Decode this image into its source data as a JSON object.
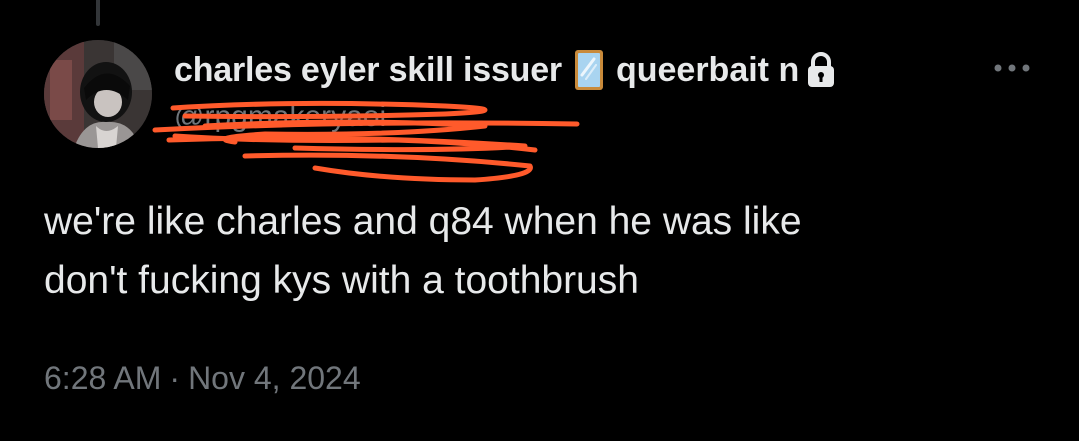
{
  "tweet": {
    "display_name": "charles eyler skill issuer",
    "name_emoji": "mirror-emoji",
    "name_suffix": "queerbait n",
    "handle": "@rpgmakeryaoi",
    "text_line_1": "we're like charles and q84 when he was like",
    "text_line_2": "don't fucking kys with a toothbrush",
    "time": "6:28 AM",
    "separator": "·",
    "date": "Nov 4, 2024"
  },
  "icons": {
    "lock": "lock-icon",
    "more": "more-options-icon",
    "avatar": "avatar"
  },
  "colors": {
    "background": "#000000",
    "primary_text": "#e7e9ea",
    "secondary_text": "#71767b",
    "scribble": "#ff5a2b"
  }
}
